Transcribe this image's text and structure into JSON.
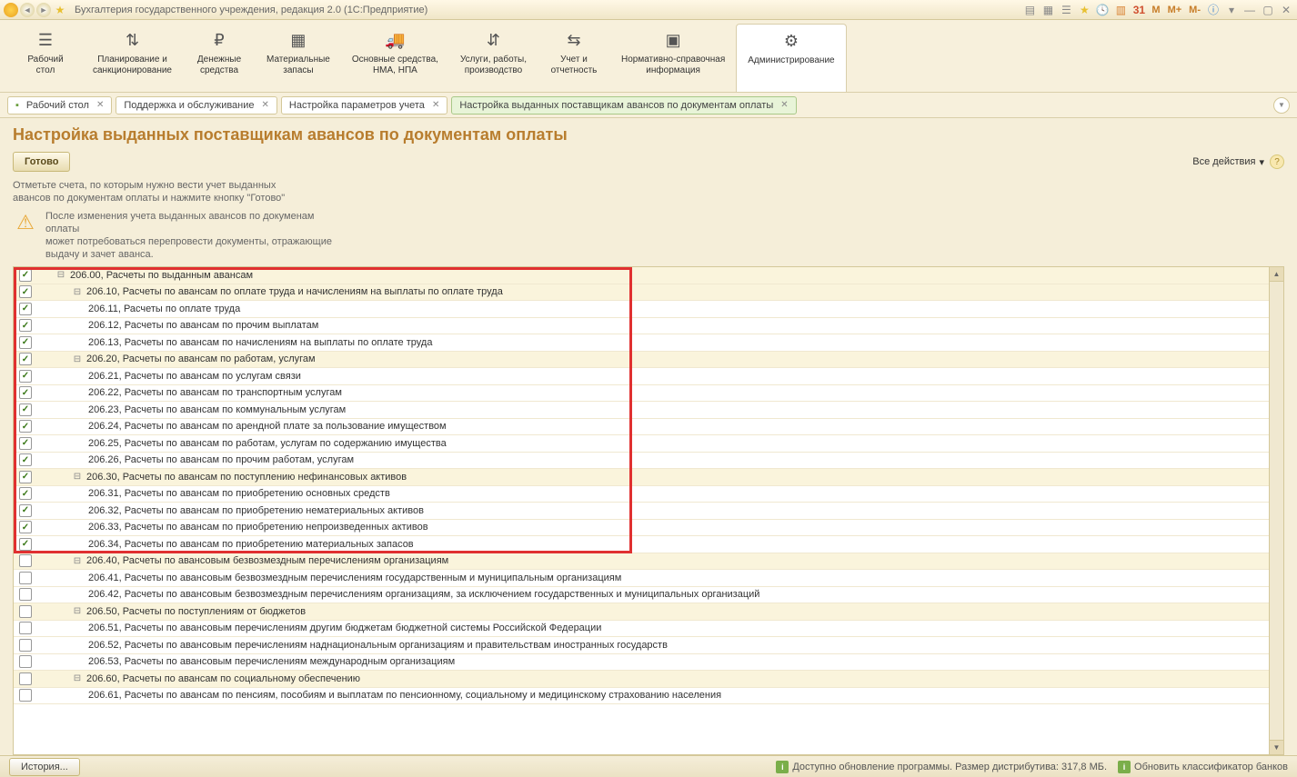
{
  "titlebar": {
    "title": "Бухгалтерия государственного учреждения, редакция 2.0  (1С:Предприятие)",
    "m_minus": "M-",
    "m_plus": "M+",
    "m": "M"
  },
  "navbar": [
    {
      "icon": "☰",
      "label": "Рабочий\nстол"
    },
    {
      "icon": "⇅",
      "label": "Планирование и\nсанкционирование"
    },
    {
      "icon": "₽",
      "label": "Денежные\nсредства"
    },
    {
      "icon": "▦",
      "label": "Материальные\nзапасы"
    },
    {
      "icon": "🚚",
      "label": "Основные средства,\nНМА, НПА"
    },
    {
      "icon": "⇵",
      "label": "Услуги, работы,\nпроизводство"
    },
    {
      "icon": "⇆",
      "label": "Учет и\nотчетность"
    },
    {
      "icon": "▣",
      "label": "Нормативно-справочная\nинформация"
    },
    {
      "icon": "⚙",
      "label": "Администрирование",
      "active": true
    }
  ],
  "tabs": [
    {
      "label": "Рабочий стол",
      "icon": true
    },
    {
      "label": "Поддержка и обслуживание"
    },
    {
      "label": "Настройка параметров учета"
    },
    {
      "label": "Настройка выданных поставщикам авансов по документам оплаты",
      "active": true
    }
  ],
  "page": {
    "title": "Настройка выданных поставщикам авансов по документам оплаты",
    "ready_btn": "Готово",
    "all_actions": "Все действия",
    "hint": "Отметьте счета, по которым нужно вести учет выданных\nавансов по документам оплаты и нажмите кнопку \"Готово\"",
    "warning": "После изменения учета выданных авансов по докуменам\nоплаты\nможет потребоваться перепровести документы, отражающие\nвыдачу и зачет аванса."
  },
  "tree": [
    {
      "checked": true,
      "level": 0,
      "group": true,
      "selected": true,
      "toggle": "−",
      "text": "206.00, Расчеты по выданным авансам",
      "red": true
    },
    {
      "checked": true,
      "level": 1,
      "group": true,
      "toggle": "−",
      "text": "206.10, Расчеты по авансам по оплате труда и начислениям на выплаты по оплате труда",
      "red": true
    },
    {
      "checked": true,
      "level": 2,
      "text": "206.11, Расчеты по оплате труда",
      "red": true
    },
    {
      "checked": true,
      "level": 2,
      "text": "206.12, Расчеты по авансам по прочим выплатам",
      "red": true
    },
    {
      "checked": true,
      "level": 2,
      "text": "206.13, Расчеты по авансам по начислениям на выплаты по оплате труда",
      "red": true
    },
    {
      "checked": true,
      "level": 1,
      "group": true,
      "toggle": "−",
      "text": "206.20, Расчеты по авансам по работам, услугам",
      "red": true
    },
    {
      "checked": true,
      "level": 2,
      "text": "206.21, Расчеты по авансам по услугам связи",
      "red": true
    },
    {
      "checked": true,
      "level": 2,
      "text": "206.22, Расчеты по авансам по транспортным услугам",
      "red": true
    },
    {
      "checked": true,
      "level": 2,
      "text": "206.23, Расчеты по авансам по коммунальным услугам",
      "red": true
    },
    {
      "checked": true,
      "level": 2,
      "text": "206.24, Расчеты по авансам по арендной плате за пользование имуществом",
      "red": true
    },
    {
      "checked": true,
      "level": 2,
      "text": "206.25, Расчеты по авансам по работам, услугам по содержанию имущества",
      "red": true
    },
    {
      "checked": true,
      "level": 2,
      "text": "206.26, Расчеты по авансам по прочим  работам, услугам",
      "red": true
    },
    {
      "checked": true,
      "level": 1,
      "group": true,
      "toggle": "−",
      "text": "206.30, Расчеты по авансам по поступлению нефинансовых активов",
      "red": true
    },
    {
      "checked": true,
      "level": 2,
      "text": "206.31, Расчеты по авансам по приобретению основных средств",
      "red": true
    },
    {
      "checked": true,
      "level": 2,
      "text": "206.32, Расчеты по авансам по приобретению нематериальных активов",
      "red": true
    },
    {
      "checked": true,
      "level": 2,
      "text": "206.33, Расчеты по авансам по приобретению непроизведенных активов",
      "red": true
    },
    {
      "checked": true,
      "level": 2,
      "text": "206.34, Расчеты по авансам по приобретению материальных запасов",
      "red": true
    },
    {
      "checked": false,
      "level": 1,
      "group": true,
      "toggle": "−",
      "text": "206.40, Расчеты по авансовым безвозмездным перечислениям организациям"
    },
    {
      "checked": false,
      "level": 2,
      "text": "206.41, Расчеты по авансовым безвозмездным перечислениям государственным и муниципальным организациям"
    },
    {
      "checked": false,
      "level": 2,
      "text": "206.42, Расчеты по авансовым  безвозмездным перечислениям организациям, за исключением государственных и муниципальных организаций"
    },
    {
      "checked": false,
      "level": 1,
      "group": true,
      "toggle": "−",
      "text": "206.50, Расчеты по поступлениям от бюджетов"
    },
    {
      "checked": false,
      "level": 2,
      "text": "206.51, Расчеты по авансовым перечислениям другим бюджетам бюджетной системы Российской Федерации"
    },
    {
      "checked": false,
      "level": 2,
      "text": "206.52, Расчеты по авансовым перечислениям наднациональным организациям и правительствам иностранных государств"
    },
    {
      "checked": false,
      "level": 2,
      "text": "206.53, Расчеты по авансовым перечислениям международным организациям"
    },
    {
      "checked": false,
      "level": 1,
      "group": true,
      "toggle": "−",
      "text": "206.60, Расчеты по авансам по социальному обеспечению"
    },
    {
      "checked": false,
      "level": 2,
      "text": "206.61, Расчеты по авансам по пенсиям, пособиям и выплатам по пенсионному, социальному и медицинскому страхованию населения"
    }
  ],
  "statusbar": {
    "history": "История...",
    "update": "Доступно обновление программы. Размер дистрибутива: 317,8 МБ.",
    "classif": "Обновить классификатор банков"
  }
}
